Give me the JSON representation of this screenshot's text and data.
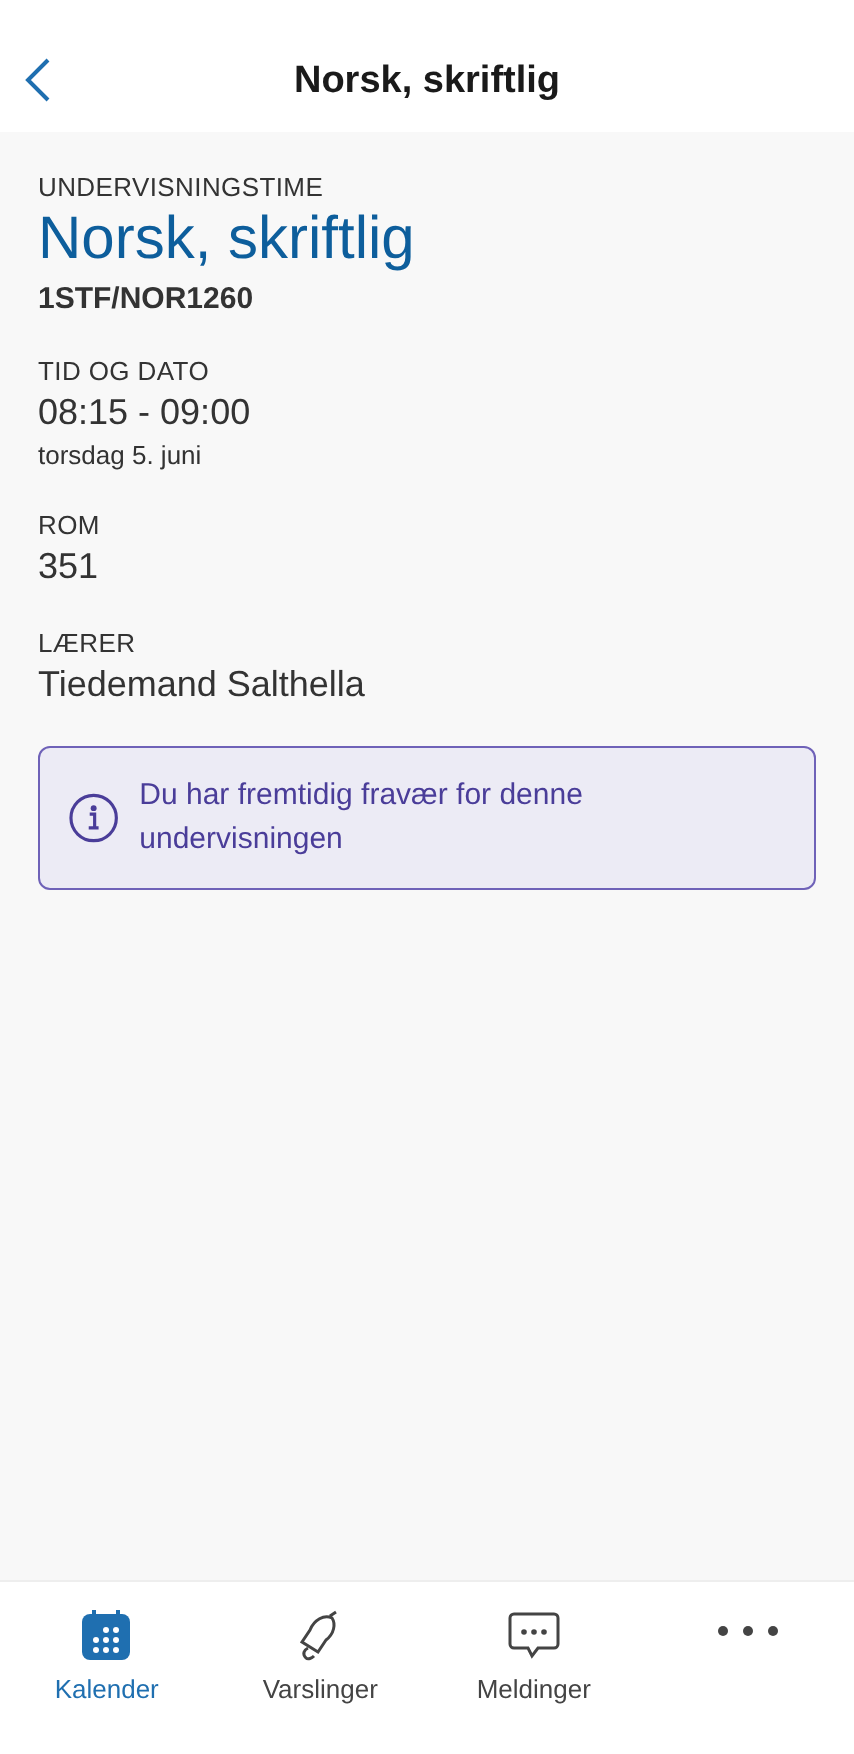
{
  "header": {
    "title": "Norsk, skriftlig"
  },
  "lesson": {
    "label": "UNDERVISNINGSTIME",
    "title": "Norsk, skriftlig",
    "code": "1STF/NOR1260"
  },
  "fields": [
    {
      "label": "TID OG DATO",
      "value": "08:15 - 09:00",
      "detail": "torsdag 5. juni"
    },
    {
      "label": "ROM",
      "value": "351"
    },
    {
      "label": "LÆRER",
      "value": "Tiedemand Salthella"
    }
  ],
  "notice": {
    "text": "Du har fremtidig fravær for denne undervisningen"
  },
  "tabs": [
    {
      "kind": "calendar",
      "label": "Kalender",
      "selected": true
    },
    {
      "kind": "bell",
      "label": "Varslinger",
      "selected": false
    },
    {
      "kind": "chat",
      "label": "Meldinger",
      "selected": false
    },
    {
      "kind": "more",
      "selected": false
    }
  ]
}
